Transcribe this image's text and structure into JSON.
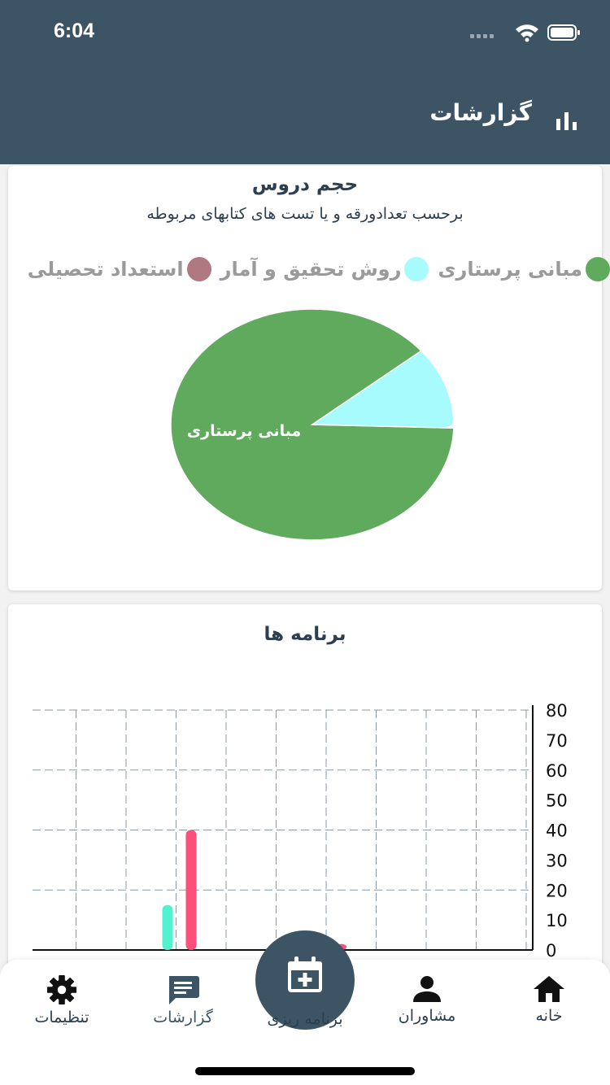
{
  "status": {
    "time": "6:04"
  },
  "header": {
    "title": "گزارشات",
    "icon": "bar-chart-icon"
  },
  "colors": {
    "header": "#3d5464",
    "green": "#60aa5e",
    "cyan": "#a8fbfc",
    "mauve": "#b07880",
    "teal": "#50f2cf",
    "pink": "#fe4f7a"
  },
  "pie_card": {
    "title": "حجم دروس",
    "subtitle": "برحسب تعدادورقه و یا تست های کتابهای مربوطه",
    "legend": [
      {
        "label": "مبانی پرستاری",
        "color": "#60aa5e"
      },
      {
        "label": "روش تحقیق و آمار",
        "color": "#a8fbfc"
      },
      {
        "label": "استعداد تحصیلی",
        "color": "#b07880"
      }
    ]
  },
  "bar_card": {
    "title": "برنامه ها"
  },
  "chart_data": [
    {
      "type": "pie",
      "title": "حجم دروس",
      "subtitle": "برحسب تعدادورقه و یا تست های کتابهای مربوطه",
      "legend_position": "top",
      "slices": [
        {
          "label": "مبانی پرستاری",
          "value": 88.5,
          "color": "#60aa5e",
          "data_label": "مبانی پرستاری"
        },
        {
          "label": "روش تحقیق و آمار",
          "value": 11.5,
          "color": "#a8fbfc",
          "data_label": "روش تحقیق و آمار"
        },
        {
          "label": "استعداد تحصیلی",
          "value": 0,
          "color": "#b07880"
        }
      ]
    },
    {
      "type": "bar",
      "title": "برنامه ها",
      "y_axis_position": "right",
      "ylim": [
        0,
        80
      ],
      "yticks": [
        0,
        10,
        20,
        30,
        40,
        50,
        60,
        70,
        80
      ],
      "grid": true,
      "series": [
        {
          "color": "#50f2cf",
          "points": [
            {
              "slot": 3,
              "value": 15
            },
            {
              "slot": 6,
              "value": 2
            }
          ]
        },
        {
          "color": "#fe4f7a",
          "points": [
            {
              "slot": 3,
              "value": 40
            },
            {
              "slot": 6,
              "value": 2
            }
          ]
        }
      ]
    }
  ],
  "nav": {
    "home": {
      "label": "خانه",
      "icon": "home-icon"
    },
    "advisors": {
      "label": "مشاوران",
      "icon": "person-icon"
    },
    "planning": {
      "label": "برنامه ریزی",
      "icon": "calendar-plus-icon"
    },
    "reports": {
      "label": "گزارشات",
      "icon": "chat-icon"
    },
    "settings": {
      "label": "تنظیمات",
      "icon": "gear-icon"
    }
  }
}
